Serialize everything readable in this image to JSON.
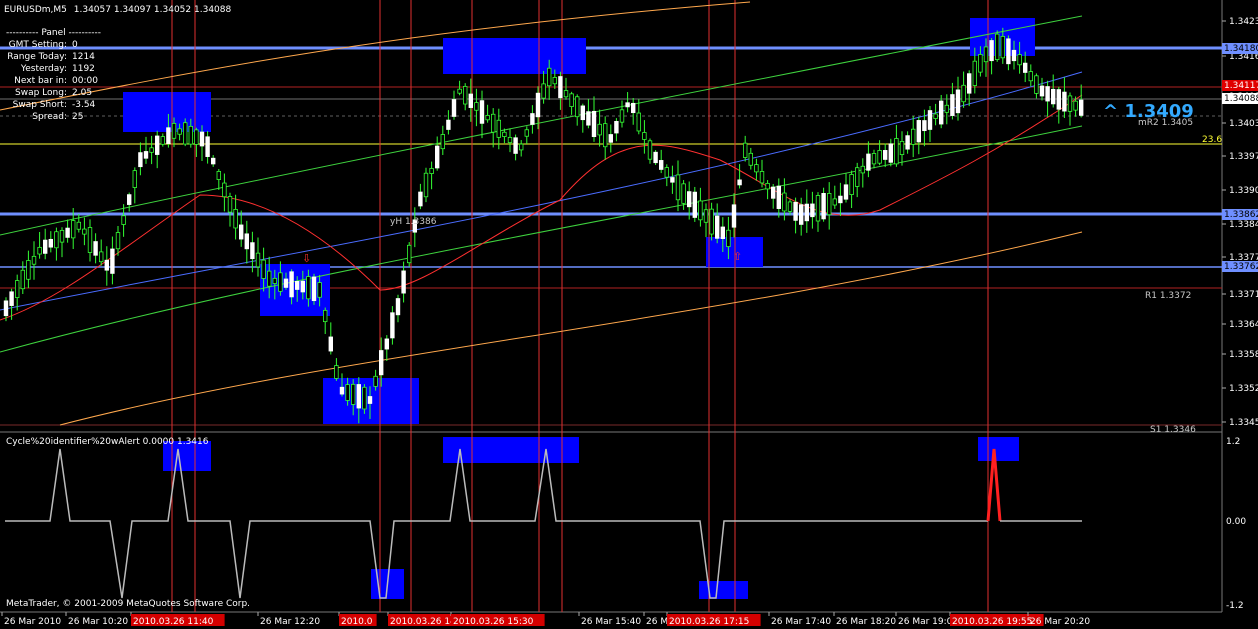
{
  "header": {
    "symbol": "EURUSDm,M5",
    "ohlc": "1.34057 1.34097 1.34052 1.34088"
  },
  "panel": {
    "title": "---------- Panel ----------",
    "rows": [
      {
        "label": "GMT Setting:",
        "value": "0"
      },
      {
        "label": "Range Today:",
        "value": "1214"
      },
      {
        "label": "Yesterday:",
        "value": "1192"
      },
      {
        "label": "Next bar in:",
        "value": "00:00"
      },
      {
        "label": "Swap Long:",
        "value": "2.05"
      },
      {
        "label": "Swap Short:",
        "value": "-3.54"
      },
      {
        "label": "Spread:",
        "value": "25"
      }
    ]
  },
  "price_axis": {
    "labels": [
      "1.34230",
      "1.34165",
      "1.34088",
      "1.34035",
      "1.33970",
      "1.33905",
      "1.33840",
      "1.33775",
      "1.33710",
      "1.33645",
      "1.33585",
      "1.33520",
      "1.33455"
    ],
    "tag_blue_top": "1.34180",
    "tag_red": "1.34117",
    "tag_current": "1.34088",
    "tag_blue_mid": "1.33862",
    "tag_blue_low": "1.33762"
  },
  "annotations": {
    "big_price": "^ 1.3409",
    "mr2": "mR2 1.3405",
    "fib": "23.6",
    "yh": "yH 1.3386",
    "r1": "R1 1.3372",
    "s1": "S1 1.3346"
  },
  "indicator": {
    "title": "Cycle%20identifier%20wAlert 0.0000 1.3416",
    "axis_top": "1.2",
    "axis_mid": "0.00",
    "axis_bottom": "-1.2",
    "copyright": "MetaTrader, © 2001-2009 MetaQuotes Software Corp."
  },
  "time_axis": {
    "labels": [
      {
        "text": "26 Mar 2010",
        "highlight": false
      },
      {
        "text": "26 Mar 10:20",
        "highlight": false
      },
      {
        "text": "2010.03.26 11:40",
        "highlight": true
      },
      {
        "text": "26 Mar 12:20",
        "highlight": false
      },
      {
        "text": "2010.0",
        "highlight": true
      },
      {
        "text": "2010.03.26 14",
        "highlight": true
      },
      {
        "text": "2010.03.26 15:30",
        "highlight": true
      },
      {
        "text": "26 Mar 15:40",
        "highlight": false
      },
      {
        "text": "26 Ma",
        "highlight": false
      },
      {
        "text": "2010.03.26 17:15",
        "highlight": true
      },
      {
        "text": "26 Mar 17:40",
        "highlight": false
      },
      {
        "text": "26 Mar 18:20",
        "highlight": false
      },
      {
        "text": "26 Mar 19:0",
        "highlight": false
      },
      {
        "text": "2010.03.26 19:55",
        "highlight": true
      },
      {
        "text": "26 Mar 20:20",
        "highlight": false
      }
    ]
  },
  "colors": {
    "background": "#000000",
    "bull_candle": "#ffffff",
    "bear_candle": "#ffffff",
    "wick": "#33ff33",
    "blue_zone": "#0000ff",
    "blue_line": "#6f8fff",
    "red_vline": "#e03030",
    "ma_red": "#ff3030",
    "ma_blue": "#4a6cff",
    "ma_green": "#3ed13e",
    "env_orange": "#ffa84d",
    "fib_yellow": "#ffff33",
    "big_price": "#33aaff"
  }
}
